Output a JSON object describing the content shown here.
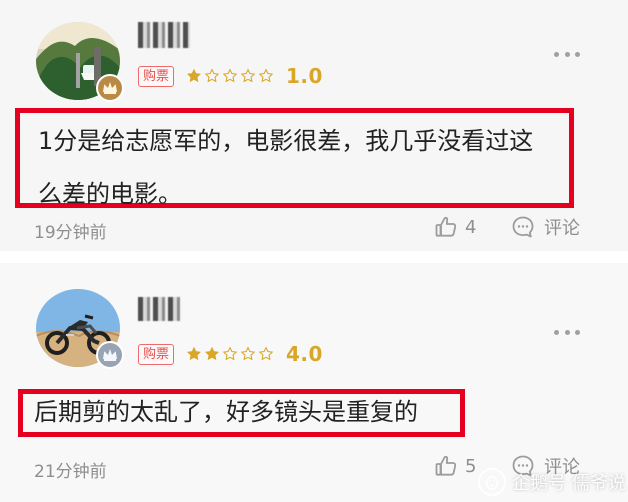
{
  "comments": [
    {
      "ticket_badge": "购票",
      "rating_value": "1.0",
      "rating_stars": 1,
      "text_line_1": "1分是给志愿军的，电影很差，我几乎没看过这",
      "text_line_2": "么差的电影。",
      "timestamp": "19分钟前",
      "likes_count": "4",
      "comment_label": "评论"
    },
    {
      "ticket_badge": "购票",
      "rating_value": "4.0",
      "rating_stars": 2,
      "text_line_1": "后期剪的太乱了，好多镜头是重复的",
      "timestamp": "21分钟前",
      "likes_count": "5",
      "comment_label": "评论"
    }
  ],
  "watermark": {
    "text": "企鹅号 儒爷说"
  },
  "colors": {
    "accent_red": "#e4001e",
    "star_gold": "#d9a628",
    "text_gray": "#8f8f8f",
    "badge_red": "#e6504f"
  },
  "icons": [
    "crown-icon",
    "star-icon",
    "thumbs-up-icon",
    "comment-bubble-icon",
    "more-icon"
  ]
}
